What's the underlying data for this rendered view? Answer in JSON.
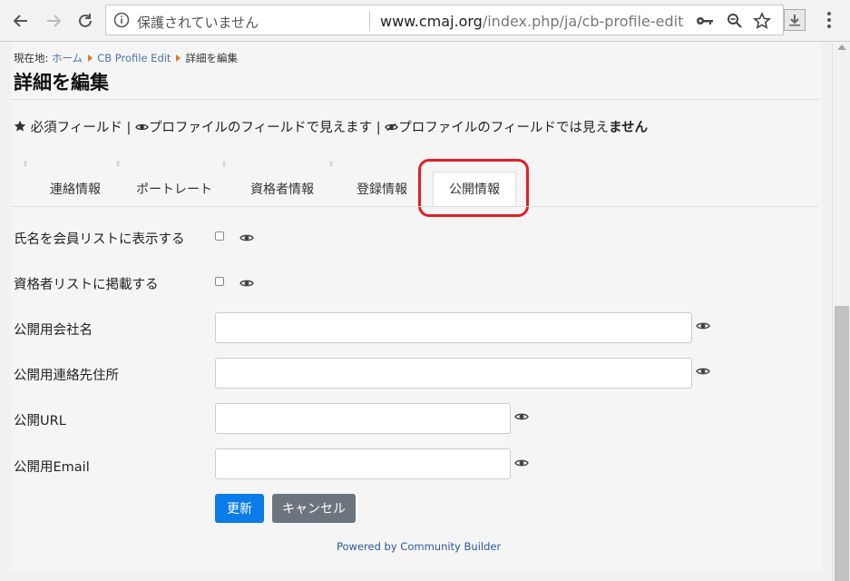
{
  "browser": {
    "back_icon": "arrow-left-icon",
    "forward_icon": "arrow-right-icon",
    "reload_icon": "reload-icon",
    "security_text": "保護されていません",
    "url_host": "www.cmaj.org",
    "url_path": "/index.php/ja/cb-profile-edit"
  },
  "breadcrumb": {
    "prefix": "現在地:",
    "items": [
      "ホーム",
      "CB Profile Edit",
      "詳細を編集"
    ]
  },
  "page": {
    "title": "詳細を編集"
  },
  "legend": {
    "required": "必須フィールド",
    "sep1": "|",
    "visible": "プロファイルのフィールドで見えます",
    "sep2": "|",
    "hidden_prefix": "プロファイルのフィールドでは見え",
    "hidden_bold": "ません"
  },
  "tabs": [
    {
      "label": "連絡情報",
      "active": false
    },
    {
      "label": "ポートレート",
      "active": false
    },
    {
      "label": "資格者情報",
      "active": false
    },
    {
      "label": "登録情報",
      "active": false
    },
    {
      "label": "公開情報",
      "active": true
    }
  ],
  "fields": {
    "show_name": {
      "label": "氏名を会員リストに表示する",
      "checked": false
    },
    "list_qualified": {
      "label": "資格者リストに掲載する",
      "checked": false
    },
    "company": {
      "label": "公開用会社名",
      "value": ""
    },
    "address": {
      "label": "公開用連絡先住所",
      "value": ""
    },
    "url": {
      "label": "公開URL",
      "value": ""
    },
    "email": {
      "label": "公開用Email",
      "value": ""
    }
  },
  "buttons": {
    "update": "更新",
    "cancel": "キャンセル"
  },
  "footer": {
    "powered": "Powered by Community Builder"
  },
  "colors": {
    "primary": "#0a7be8",
    "secondary": "#6c757d",
    "highlight": "#e02025",
    "breadcrumb_caret": "#e07a1f"
  }
}
